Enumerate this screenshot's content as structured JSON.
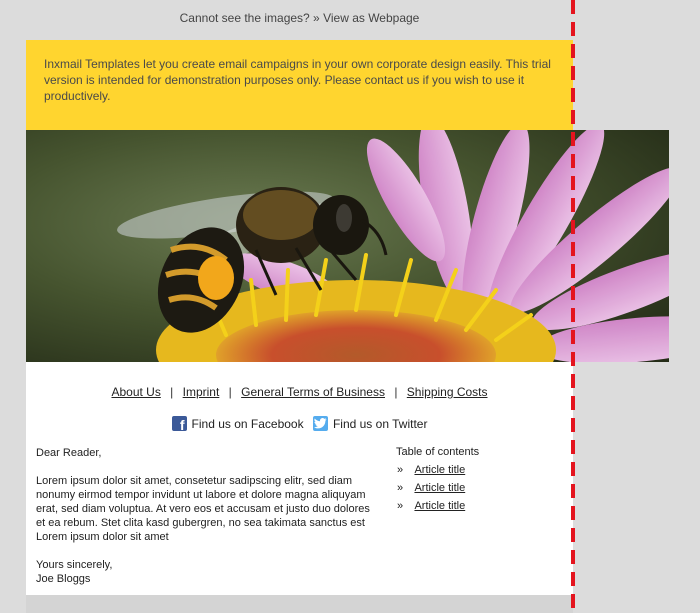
{
  "preheader": {
    "text": "Cannot see the images? » View as Webpage"
  },
  "notice": {
    "text": "Inxmail Templates let you create email campaigns in your own corporate design easily. This trial version is intended for demonstration purposes only. Please contact us if you wish to use it productively."
  },
  "hero": {
    "subject": "bee-on-flower-photo"
  },
  "nav": {
    "links": [
      "About Us",
      "Imprint",
      "General Terms of Business",
      "Shipping Costs"
    ],
    "separator": "|"
  },
  "social": {
    "facebook": "Find us on Facebook",
    "twitter": "Find us on Twitter"
  },
  "letter": {
    "greeting": "Dear Reader,",
    "body": "Lorem ipsum dolor sit amet, consetetur sadipscing elitr, sed diam nonumy eirmod tempor invidunt ut labore et dolore magna aliquyam erat, sed diam voluptua. At vero eos et accusam et justo duo dolores et ea rebum. Stet clita kasd gubergren, no sea takimata sanctus est Lorem ipsum dolor sit amet",
    "closing": "Yours sincerely,",
    "signature": "Joe Bloggs"
  },
  "toc": {
    "title": "Table of contents",
    "bullet": "»",
    "items": [
      "Article title",
      "Article title",
      "Article title"
    ]
  },
  "colors": {
    "notice_bg": "#ffd52f",
    "page_bg": "#dcdcdc",
    "guide": "#e4141e",
    "facebook": "#3b5998",
    "twitter": "#55acee"
  }
}
